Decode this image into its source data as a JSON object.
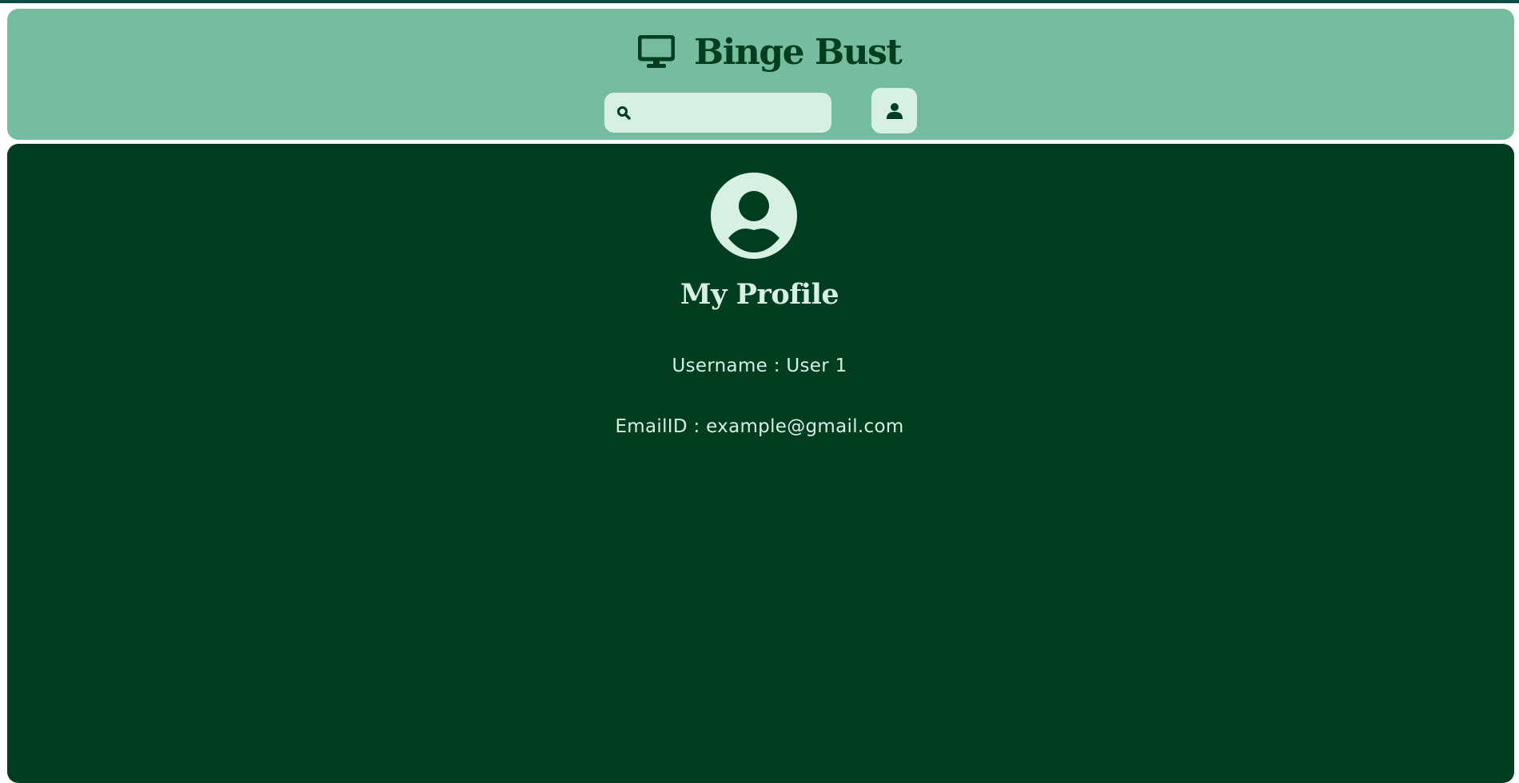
{
  "header": {
    "brand_icon": "monitor-icon",
    "title": "Binge Bust",
    "search": {
      "icon": "search-icon",
      "placeholder": "",
      "value": ""
    },
    "user_button_icon": "user-icon"
  },
  "profile": {
    "avatar_icon": "user-circle-icon",
    "title": "My Profile",
    "username_line": "Username : User 1",
    "email_line": "EmailID : example@gmail.com"
  },
  "colors": {
    "header_bg": "#76bc9e",
    "main_bg": "#003d21",
    "light": "#d6f0e3",
    "dark_text": "#003d21",
    "top_line": "#0b4d45"
  }
}
